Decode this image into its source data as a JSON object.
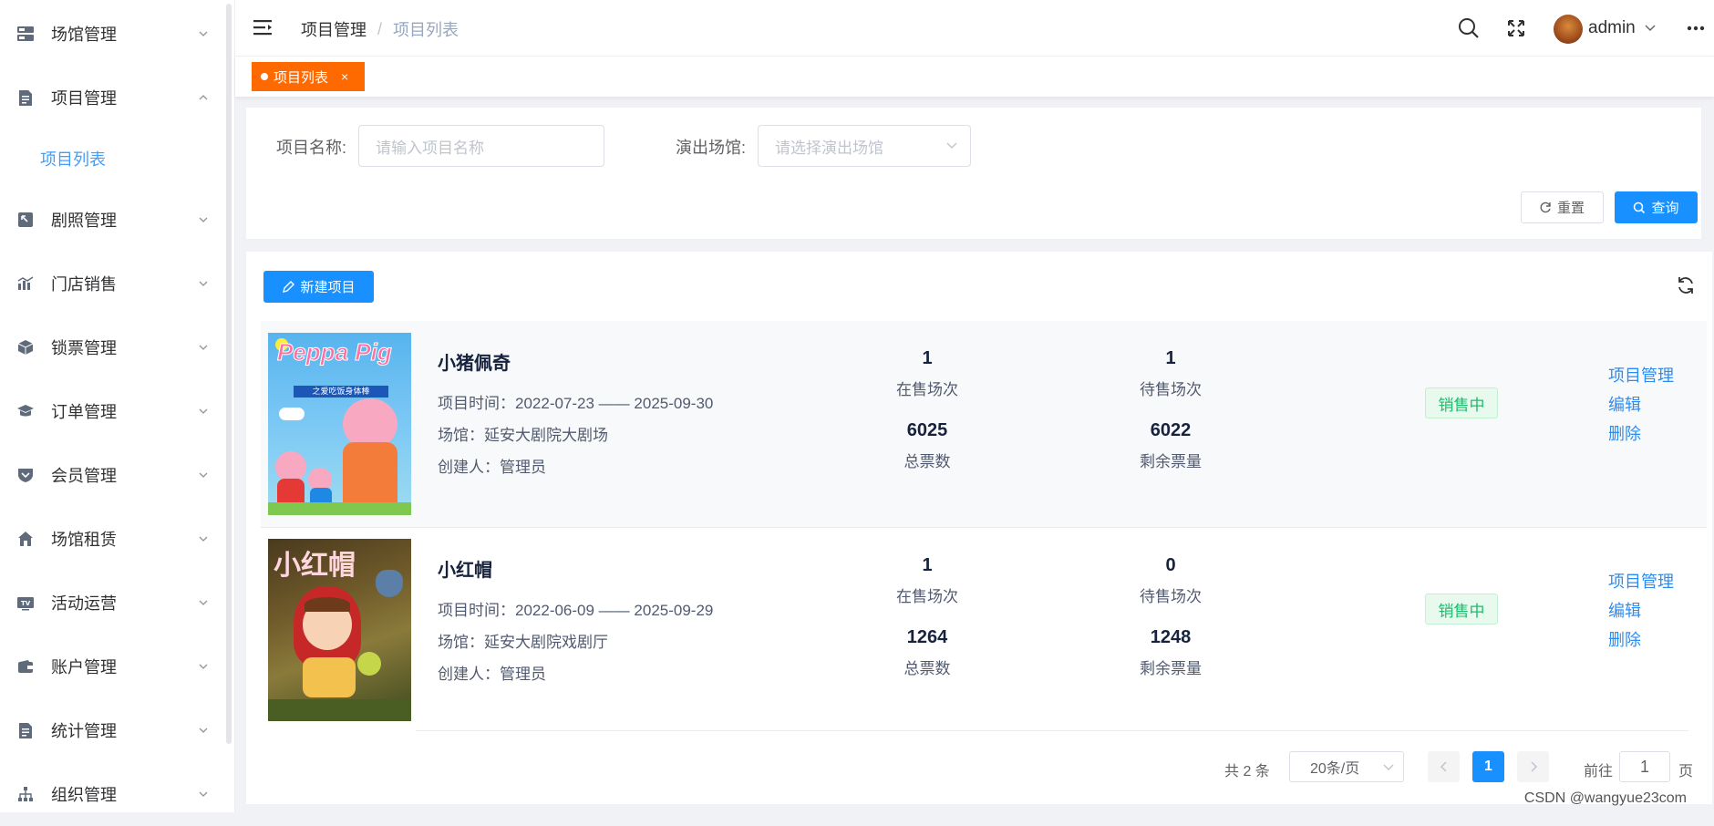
{
  "sidebar": {
    "items": [
      {
        "label": "场馆管理",
        "icon": "server-icon",
        "expanded": false
      },
      {
        "label": "项目管理",
        "icon": "document-icon",
        "expanded": true
      },
      {
        "label": "剧照管理",
        "icon": "image-icon",
        "expanded": false
      },
      {
        "label": "门店销售",
        "icon": "chart-icon",
        "expanded": false
      },
      {
        "label": "锁票管理",
        "icon": "box-icon",
        "expanded": false
      },
      {
        "label": "订单管理",
        "icon": "graduation-icon",
        "expanded": false
      },
      {
        "label": "会员管理",
        "icon": "shield-icon",
        "expanded": false
      },
      {
        "label": "场馆租赁",
        "icon": "home-icon",
        "expanded": false
      },
      {
        "label": "活动运营",
        "icon": "tv-icon",
        "expanded": false
      },
      {
        "label": "账户管理",
        "icon": "wallet-icon",
        "expanded": false
      },
      {
        "label": "统计管理",
        "icon": "document-icon",
        "expanded": false
      },
      {
        "label": "组织管理",
        "icon": "org-tree-icon",
        "expanded": false
      }
    ],
    "active_sub": "项目列表"
  },
  "header": {
    "breadcrumb": [
      "项目管理",
      "项目列表"
    ],
    "separator": "/",
    "user": "admin"
  },
  "tags": {
    "active": "项目列表",
    "close": "×"
  },
  "search": {
    "name_label": "项目名称:",
    "name_placeholder": "请输入项目名称",
    "venue_label": "演出场馆:",
    "venue_placeholder": "请选择演出场馆",
    "reset": "重置",
    "query": "查询"
  },
  "toolbar": {
    "new_project": "新建项目"
  },
  "projects": [
    {
      "name": "小猪佩奇",
      "time": "项目时间：2022-07-23 —— 2025-09-30",
      "venue": "场馆：延安大剧院大剧场",
      "creator": "创建人：管理员",
      "on_sale": "1",
      "on_sale_label": "在售场次",
      "pending": "1",
      "pending_label": "待售场次",
      "total": "6025",
      "total_label": "总票数",
      "remaining": "6022",
      "remaining_label": "剩余票量",
      "status": "销售中",
      "actions": [
        "项目管理",
        "编辑",
        "删除"
      ],
      "poster_text": "Peppa Pig",
      "poster_sub": "之爱吃饭身体棒"
    },
    {
      "name": "小红帽",
      "time": "项目时间：2022-06-09 —— 2025-09-29",
      "venue": "场馆：延安大剧院戏剧厅",
      "creator": "创建人：管理员",
      "on_sale": "1",
      "on_sale_label": "在售场次",
      "pending": "0",
      "pending_label": "待售场次",
      "total": "1264",
      "total_label": "总票数",
      "remaining": "1248",
      "remaining_label": "剩余票量",
      "status": "销售中",
      "actions": [
        "项目管理",
        "编辑",
        "删除"
      ],
      "poster_text": "小红帽"
    }
  ],
  "pagination": {
    "total": "共 2 条",
    "page_size": "20条/页",
    "current": "1",
    "goto_label": "前往",
    "goto_value": "1",
    "page_unit": "页"
  },
  "watermark": "CSDN @wangyue23com",
  "colors": {
    "primary": "#1890ff",
    "tag": "#ff6a00",
    "status": "#19be6b",
    "link": "#2d8cf0"
  }
}
